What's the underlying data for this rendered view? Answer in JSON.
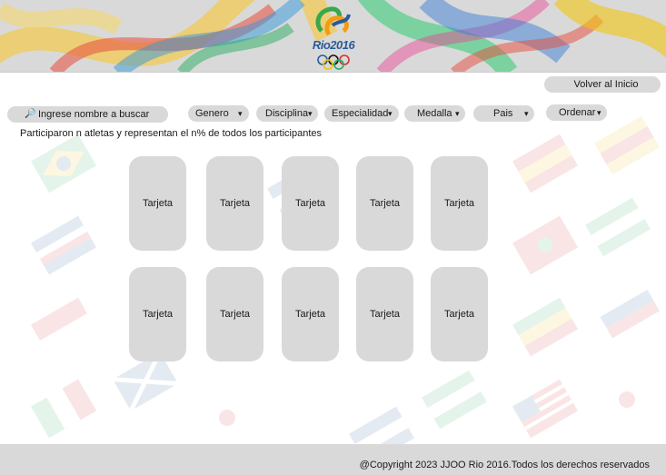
{
  "header": {
    "logo_text": "Rio2016",
    "back_button": "Volver al Inicio"
  },
  "filters": {
    "search_label": "Ingrese nombre a buscar",
    "genero": "Genero",
    "disciplina": "Disciplina",
    "especialidad": "Especialidad",
    "medalla": "Medalla",
    "pais": "Pais",
    "ordenar": "Ordenar",
    "caret": "▾"
  },
  "summary": "Participaron n atletas y representan el n% de todos los participantes",
  "cards": [
    {
      "label": "Tarjeta"
    },
    {
      "label": "Tarjeta"
    },
    {
      "label": "Tarjeta"
    },
    {
      "label": "Tarjeta"
    },
    {
      "label": "Tarjeta"
    },
    {
      "label": "Tarjeta"
    },
    {
      "label": "Tarjeta"
    },
    {
      "label": "Tarjeta"
    },
    {
      "label": "Tarjeta"
    },
    {
      "label": "Tarjeta"
    }
  ],
  "footer": {
    "copyright": "@Copyright 2023 JJOO Rio 2016.Todos los derechos reservados"
  },
  "colors": {
    "control_bg": "#d9d9d9",
    "logo_blue": "#2a5b9b",
    "logo_green": "#3aa84a",
    "logo_orange": "#f39c12"
  }
}
